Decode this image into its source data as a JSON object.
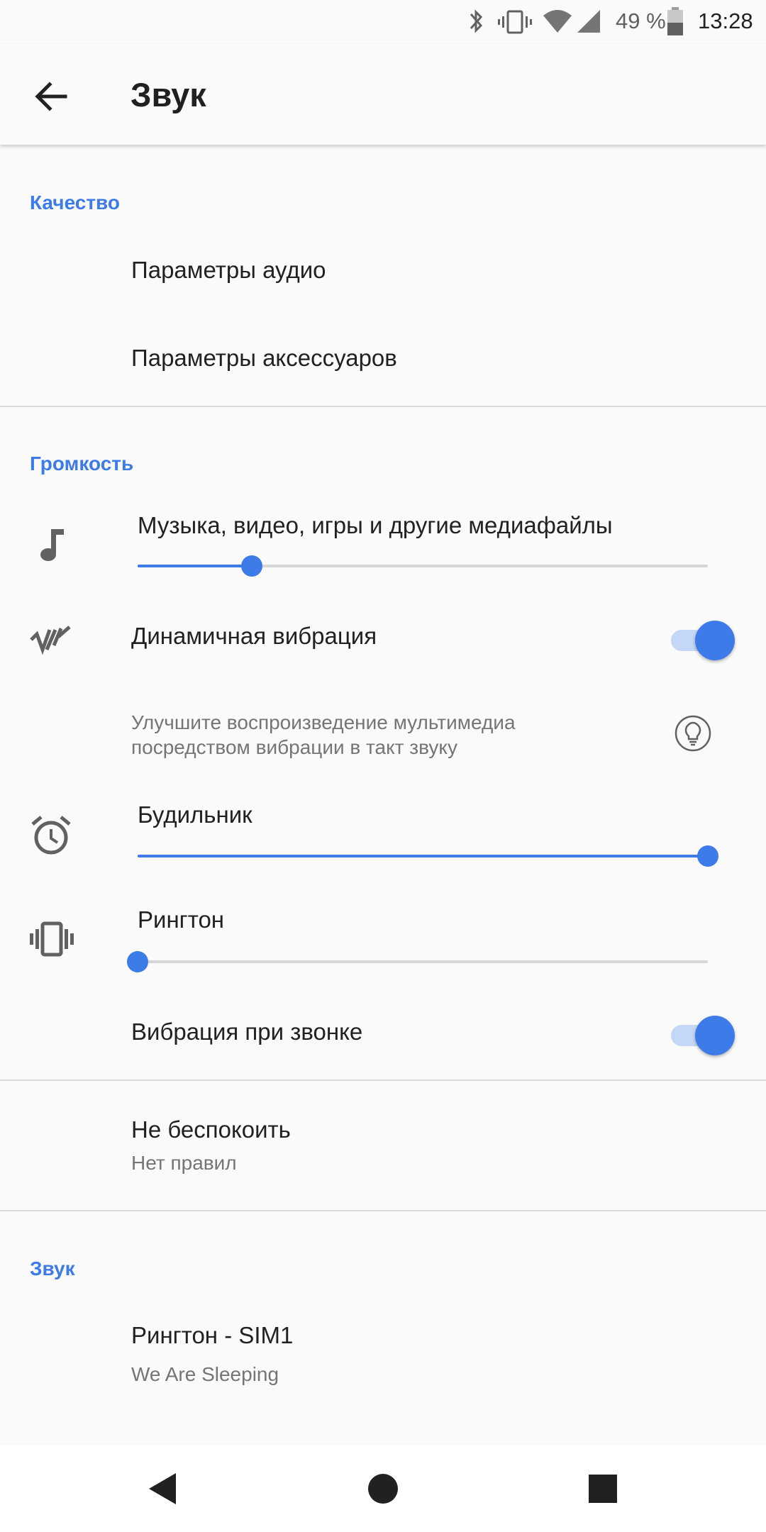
{
  "status_bar": {
    "battery_text": "49 %",
    "time": "13:28",
    "icons": [
      "bluetooth-icon",
      "vibrate-icon",
      "wifi-icon",
      "cell-signal-icon",
      "battery-icon"
    ]
  },
  "header": {
    "title": "Звук",
    "back_icon": "arrow-back-icon"
  },
  "quality": {
    "header": "Качество",
    "audio_settings": "Параметры аудио",
    "accessory_settings": "Параметры аксессуаров"
  },
  "volume": {
    "header": "Громкость",
    "media": {
      "label": "Музыка, видео, игры и другие медиафайлы",
      "level": 0.2,
      "icon": "music-note-icon"
    },
    "dynamic_vibration": {
      "label": "Динамичная вибрация",
      "enabled": true,
      "description": "Улучшите воспроизведение мультимедиа посредством вибрации в такт звуку",
      "icon": "dynamic-vibration-icon",
      "hint_icon": "lightbulb-icon"
    },
    "alarm": {
      "label": "Будильник",
      "level": 1.0,
      "icon": "alarm-clock-icon"
    },
    "ringtone": {
      "label": "Рингтон",
      "level": 0.0,
      "icon": "vibrate-icon"
    },
    "vibrate_on_ring": {
      "label": "Вибрация при звонке",
      "enabled": true
    }
  },
  "dnd": {
    "title": "Не беспокоить",
    "subtitle": "Нет правил"
  },
  "sound": {
    "header": "Звук",
    "ringtone_sim1": {
      "title": "Рингтон - SIM1",
      "value": "We Are Sleeping"
    }
  },
  "colors": {
    "accent": "#3d7be8",
    "background": "#fafafa"
  },
  "nav_bar": {
    "icons": [
      "back-triangle-icon",
      "home-circle-icon",
      "recents-square-icon"
    ]
  }
}
